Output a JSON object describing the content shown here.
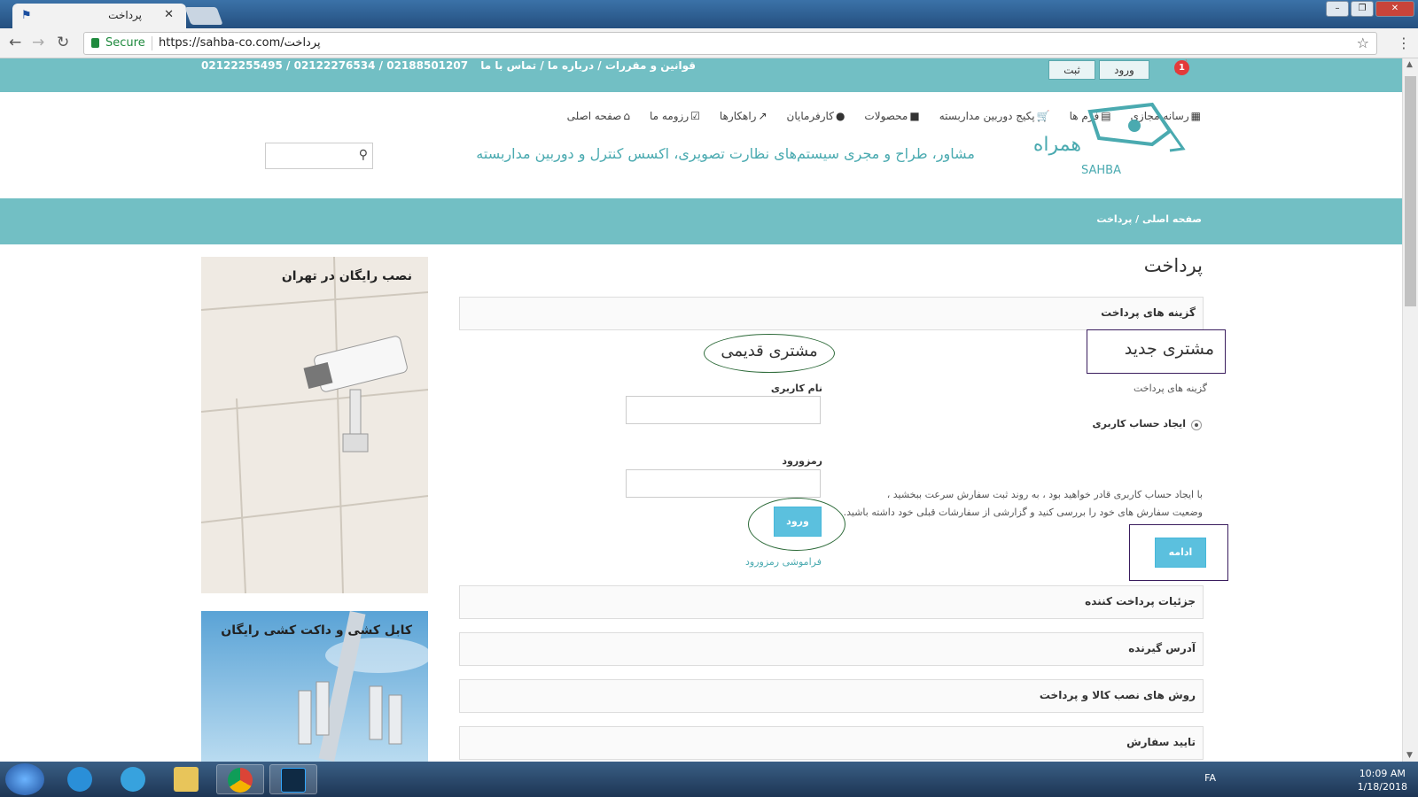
{
  "browser": {
    "tab_title": "پرداخت",
    "secure_label": "Secure",
    "url": "https://sahba-co.com/پرداخت"
  },
  "topbar": {
    "links": "قوانین و مقررات / درباره ما / تماس با ما",
    "phones": "02188501207 / 02122276534 / 02122255495",
    "register_label": "ثبت",
    "login_label": "ورود",
    "cart_count": "1"
  },
  "nav": {
    "items": [
      "صفحه اصلی",
      "رزومه ما",
      "راهکارها",
      "کارفرمایان",
      "محصولات",
      "پکیج دوربین مداربسته",
      "فرم ها",
      "رسانه مجازی"
    ]
  },
  "logo": {
    "text_fa": "همراه صهبا",
    "text_en": "SAHBA"
  },
  "tagline": "مشاور، طراح و مجری سیستم‌های نظارت تصویری، اکسس کنترل و دوربین مداربسته",
  "breadcrumb": "صفحه اصلی / پرداخت",
  "page_title": "پرداخت",
  "panels": {
    "payment_options": "گزینه های پرداخت",
    "payer_details": "جزئیات پرداخت کننده",
    "shipping_address": "آدرس گیرنده",
    "install_methods": "روش های نصب کالا و پرداخت",
    "confirm_order": "تایید سفارش"
  },
  "new_customer": {
    "heading": "مشتری جدید",
    "subtitle": "گزینه های پرداخت",
    "radio_label": "ایجاد حساب کاربری",
    "desc_line1": "با ایجاد حساب کاربری قادر خواهید بود ، به روند ثبت سفارش سرعت ببخشید ،",
    "desc_line2": "وضعیت سفارش های خود را بررسی کنید و گزارشی از سفارشات قبلی خود داشته باشید.",
    "continue_label": "ادامه"
  },
  "returning_customer": {
    "heading": "مشتری قدیمی",
    "username_label": "نام کاربری",
    "password_label": "رمزورود",
    "login_label": "ورود",
    "forgot_label": "فراموشی رمزورود"
  },
  "banners": {
    "banner1_title": "نصب رایگان در تهران",
    "banner2_title": "کابل کشی و داکت کشی رایگان"
  },
  "taskbar": {
    "lang": "FA",
    "time": "10:09 AM",
    "date": "1/18/2018"
  },
  "colors": {
    "teal": "#72bfc4",
    "accent_blue": "#5bc0de",
    "annotation_purple": "#3a1d5e",
    "annotation_green": "#2e6b3a"
  }
}
